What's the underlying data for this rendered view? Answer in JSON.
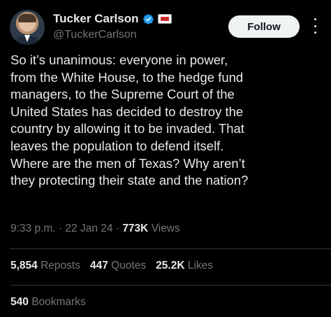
{
  "author": {
    "display_name": "Tucker Carlson",
    "handle": "@TuckerCarlson",
    "verified_icon": "verified-badge-icon",
    "affiliate_icon": "affiliate-badge-icon"
  },
  "actions": {
    "follow_label": "Follow",
    "more_icon": "more-options-icon"
  },
  "tweet": {
    "lines": [
      "So it’s unanimous: everyone in power,",
      "from the White House, to the hedge fund",
      "managers, to the Supreme Court of the",
      "United States has decided to destroy the",
      "country by allowing it to be invaded. That",
      "leaves the population to defend itself.",
      "Where are the men of Texas? Why aren’t",
      "they protecting their state and the nation?"
    ]
  },
  "meta": {
    "time": "9:33 p.m.",
    "separator": "·",
    "date": "22 Jan 24",
    "views_count": "773K",
    "views_label": "Views"
  },
  "stats": {
    "reposts_count": "5,854",
    "reposts_label": "Reposts",
    "quotes_count": "447",
    "quotes_label": "Quotes",
    "likes_count": "25.2K",
    "likes_label": "Likes",
    "bookmarks_count": "540",
    "bookmarks_label": "Bookmarks"
  },
  "colors": {
    "background": "#000000",
    "text_primary": "#e7e9ea",
    "text_secondary": "#71767b",
    "verified_blue": "#1d9bf0",
    "follow_button_bg": "#eff3f4",
    "divider": "#2f3336"
  }
}
